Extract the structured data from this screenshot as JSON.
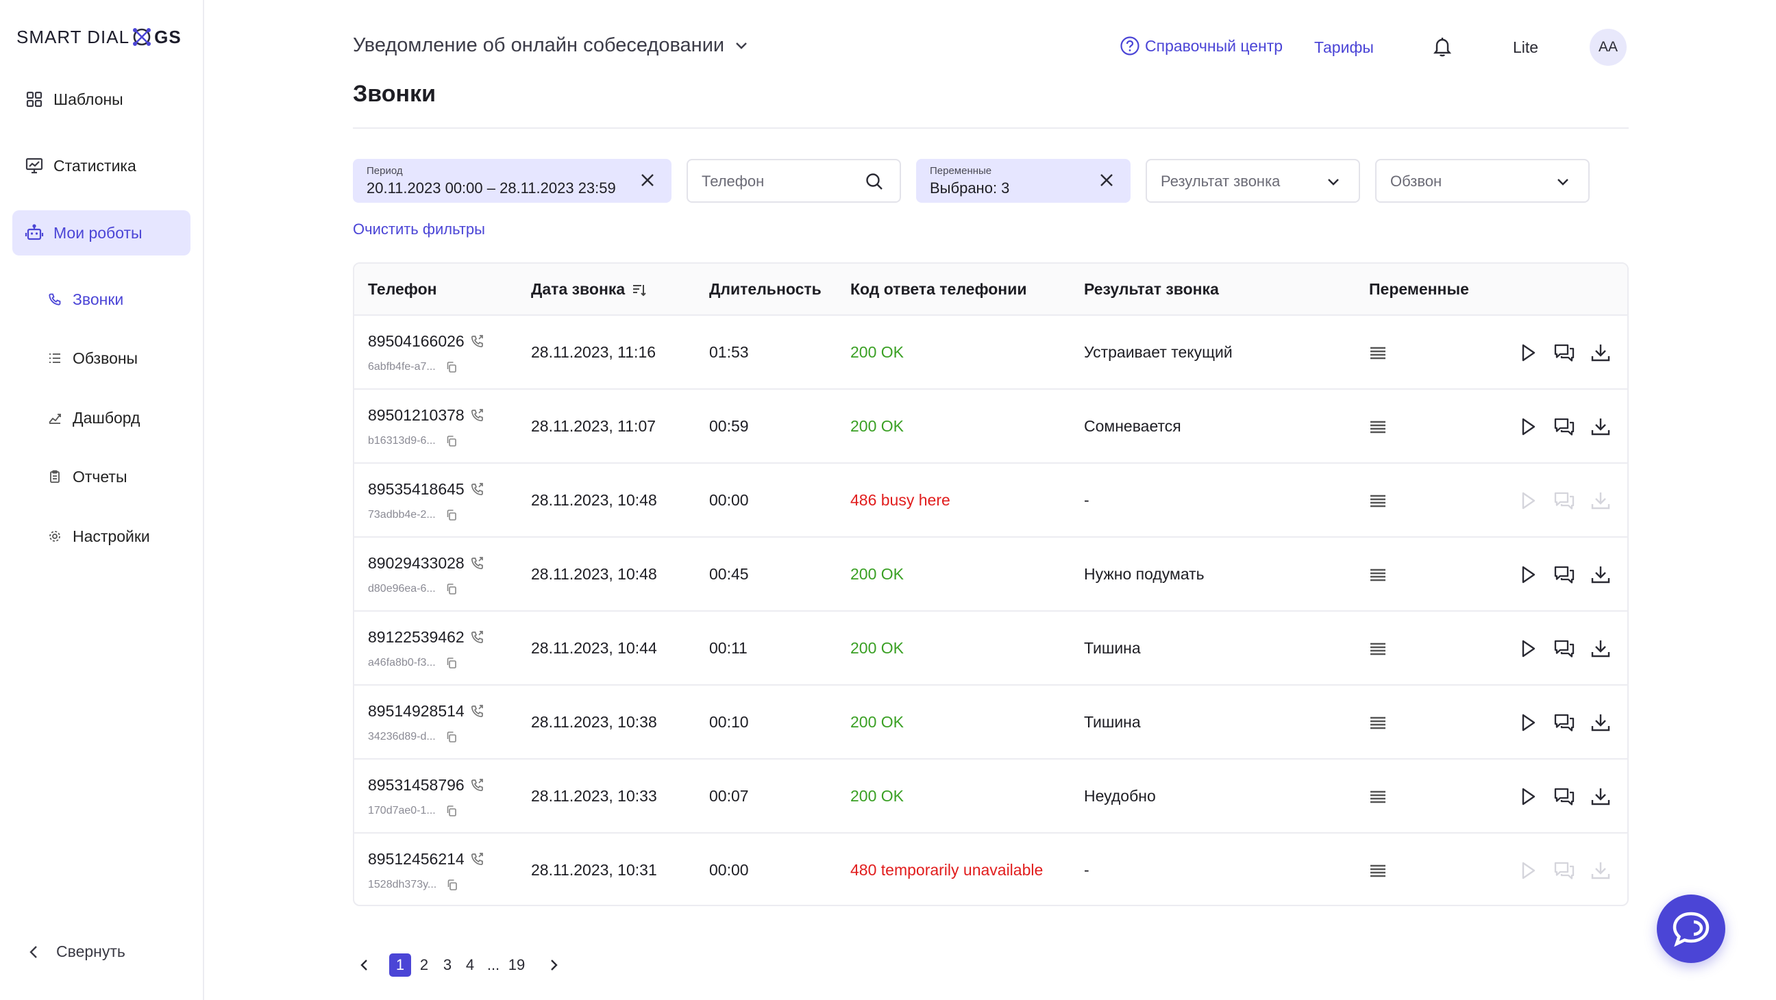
{
  "brand": {
    "logo_part1": "SMART DIAL",
    "logo_part2": "GS"
  },
  "sidebar": {
    "items": [
      {
        "label": "Шаблоны",
        "icon": "grid-icon"
      },
      {
        "label": "Статистика",
        "icon": "statistics-icon"
      },
      {
        "label": "Мои роботы",
        "icon": "robot-icon",
        "active": true
      }
    ],
    "sub_items": [
      {
        "label": "Звонки",
        "icon": "phone-icon",
        "active": true
      },
      {
        "label": "Обзвоны",
        "icon": "list-icon"
      },
      {
        "label": "Дашборд",
        "icon": "dashboard-icon"
      },
      {
        "label": "Отчеты",
        "icon": "report-icon"
      },
      {
        "label": "Настройки",
        "icon": "settings-icon"
      }
    ],
    "collapse_label": "Свернуть"
  },
  "header": {
    "project": "Уведомление об онлайн собеседовании",
    "help": "Справочный центр",
    "tariffs": "Тарифы",
    "plan": "Lite",
    "avatar": "AA"
  },
  "page_title": "Звонки",
  "filters": {
    "period_label": "Период",
    "period_value": "20.11.2023 00:00 – 28.11.2023 23:59",
    "phone_placeholder": "Телефон",
    "variables_label": "Переменные",
    "variables_value": "Выбрано: 3",
    "result_placeholder": "Результат звонка",
    "campaign_placeholder": "Обзвон",
    "clear": "Очистить фильтры"
  },
  "table": {
    "columns": [
      "Телефон",
      "Дата звонка",
      "Длительность",
      "Код ответа телефонии",
      "Результат звонка",
      "Переменные"
    ],
    "rows": [
      {
        "phone": "89504166026",
        "id": "6abfb4fe-a7...",
        "date": "28.11.2023, 11:16",
        "duration": "01:53",
        "code": "200 OK",
        "status": "ok",
        "result": "Устраивает текущий"
      },
      {
        "phone": "89501210378",
        "id": "b16313d9-6...",
        "date": "28.11.2023, 11:07",
        "duration": "00:59",
        "code": "200 OK",
        "status": "ok",
        "result": "Сомневается"
      },
      {
        "phone": "89535418645",
        "id": "73adbb4e-2...",
        "date": "28.11.2023, 10:48",
        "duration": "00:00",
        "code": "486 busy here",
        "status": "err",
        "result": "-"
      },
      {
        "phone": "89029433028",
        "id": "d80e96ea-6...",
        "date": "28.11.2023, 10:48",
        "duration": "00:45",
        "code": "200 OK",
        "status": "ok",
        "result": "Нужно подумать"
      },
      {
        "phone": "89122539462",
        "id": "a46fa8b0-f3...",
        "date": "28.11.2023, 10:44",
        "duration": "00:11",
        "code": "200 OK",
        "status": "ok",
        "result": "Тишина"
      },
      {
        "phone": "89514928514",
        "id": "34236d89-d...",
        "date": "28.11.2023, 10:38",
        "duration": "00:10",
        "code": "200 OK",
        "status": "ok",
        "result": "Тишина"
      },
      {
        "phone": "89531458796",
        "id": "170d7ae0-1...",
        "date": "28.11.2023, 10:33",
        "duration": "00:07",
        "code": "200 OK",
        "status": "ok",
        "result": "Неудобно"
      },
      {
        "phone": "89512456214",
        "id": "1528dh373y...",
        "date": "28.11.2023, 10:31",
        "duration": "00:00",
        "code": "480 temporarily unavailable",
        "status": "err",
        "result": "-"
      }
    ]
  },
  "pagination": {
    "pages": [
      "1",
      "2",
      "3",
      "4",
      "...",
      "19"
    ],
    "current": "1"
  },
  "colors": {
    "accent": "#4b45d6",
    "accent_light": "#e6e6ff",
    "ok": "#3aa024",
    "error": "#e11d1d"
  }
}
